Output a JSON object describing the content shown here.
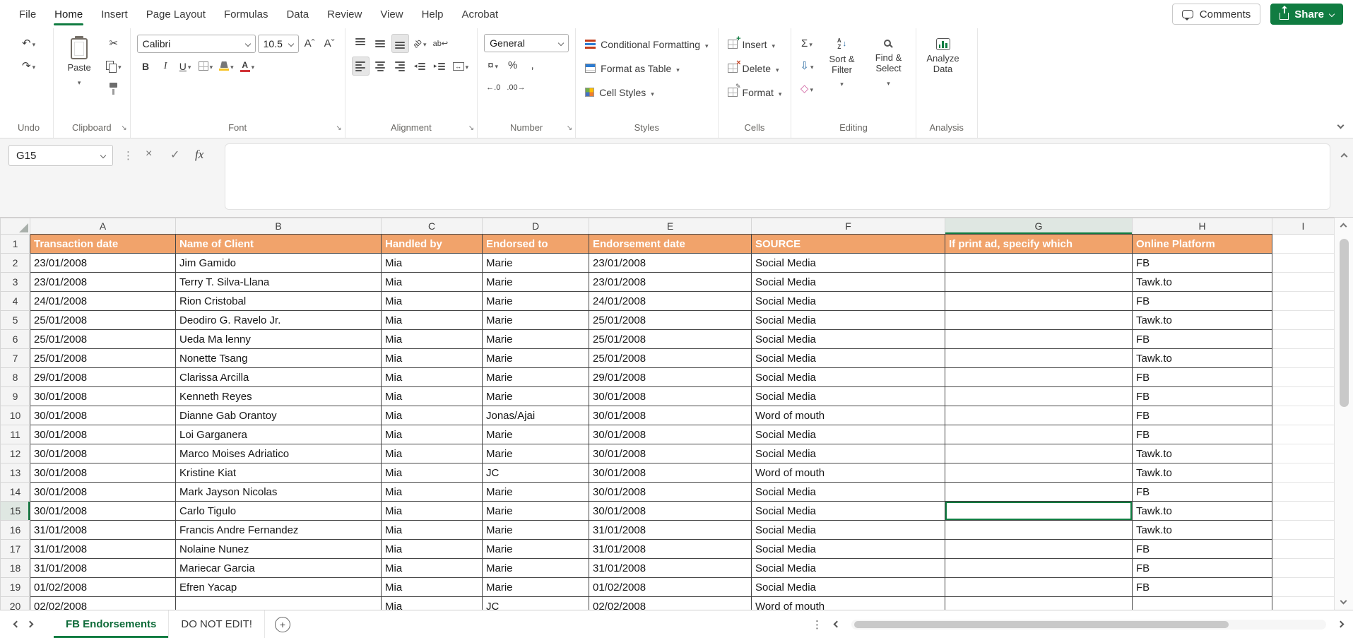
{
  "colors": {
    "accent_green": "#107C41",
    "header_fill": "#F1A36B",
    "header_text": "#FFFFFF",
    "grid_border": "#454545"
  },
  "menu": {
    "items": [
      "File",
      "Home",
      "Insert",
      "Page Layout",
      "Formulas",
      "Data",
      "Review",
      "View",
      "Help",
      "Acrobat"
    ],
    "active_item": "Home",
    "comments_label": "Comments",
    "share_label": "Share"
  },
  "ribbon": {
    "undo": {
      "label": "Undo"
    },
    "clipboard": {
      "label": "Clipboard",
      "paste_label": "Paste"
    },
    "font": {
      "label": "Font",
      "font_name": "Calibri",
      "font_size": "10.5"
    },
    "alignment": {
      "label": "Alignment"
    },
    "number": {
      "label": "Number",
      "format": "General"
    },
    "styles": {
      "label": "Styles",
      "conditional_formatting": "Conditional Formatting",
      "format_as_table": "Format as Table",
      "cell_styles": "Cell Styles"
    },
    "cells": {
      "label": "Cells",
      "insert": "Insert",
      "delete": "Delete",
      "format": "Format"
    },
    "editing": {
      "label": "Editing",
      "sort_filter": "Sort & Filter",
      "find_select": "Find & Select"
    },
    "analysis": {
      "label": "Analysis",
      "analyze_data": "Analyze Data"
    }
  },
  "icons": {
    "undo": "↶",
    "redo": "↷",
    "scissors": "✂",
    "bold": "B",
    "italic": "I",
    "underline": "U",
    "grow_font": "Aˆ",
    "shrink_font": "Aˇ",
    "orientation_ab": "ab",
    "wrap_ab": "ab",
    "wrap_arrow": "↩",
    "merge_arrows": "↔",
    "accounting": "¤",
    "percent": "%",
    "comma": ",",
    "increase_decimal": "←.0",
    "decrease_decimal": ".00→",
    "autosum": "Σ",
    "fill_down": "⇩",
    "clear_diamond": "◇",
    "sort_a": "A",
    "sort_z": "Z",
    "sort_arrow": "↓",
    "indent_left_arrow": "◂",
    "indent_right_arrow": "▸",
    "ellipsis_v": "⋮",
    "plus": "+",
    "cancel": "×",
    "check": "✓",
    "launcher": "↘"
  },
  "formula_bar": {
    "name_box": "G15",
    "fx_label": "fx",
    "formula_value": ""
  },
  "sheet": {
    "column_letters": [
      "A",
      "B",
      "C",
      "D",
      "E",
      "F",
      "G",
      "H",
      "I"
    ],
    "header_row": [
      "Transaction date",
      "Name of Client",
      "Handled by",
      "Endorsed to",
      "Endorsement date",
      "SOURCE",
      "If print ad, specify which",
      "Online Platform"
    ],
    "rows": [
      {
        "n": 2,
        "cells": [
          "23/01/2008",
          "Jim Gamido",
          "Mia",
          "Marie",
          "23/01/2008",
          "Social Media",
          "",
          "FB"
        ]
      },
      {
        "n": 3,
        "cells": [
          "23/01/2008",
          "Terry T. Silva-Llana",
          "Mia",
          "Marie",
          "23/01/2008",
          "Social Media",
          "",
          "Tawk.to"
        ]
      },
      {
        "n": 4,
        "cells": [
          "24/01/2008",
          "Rion Cristobal",
          "Mia",
          "Marie",
          "24/01/2008",
          "Social Media",
          "",
          "FB"
        ]
      },
      {
        "n": 5,
        "cells": [
          "25/01/2008",
          "Deodiro G. Ravelo Jr.",
          "Mia",
          "Marie",
          "25/01/2008",
          "Social Media",
          "",
          "Tawk.to"
        ]
      },
      {
        "n": 6,
        "cells": [
          "25/01/2008",
          "Ueda Ma lenny",
          "Mia",
          "Marie",
          "25/01/2008",
          "Social Media",
          "",
          "FB"
        ]
      },
      {
        "n": 7,
        "cells": [
          "25/01/2008",
          "Nonette Tsang",
          "Mia",
          "Marie",
          "25/01/2008",
          "Social Media",
          "",
          "Tawk.to"
        ]
      },
      {
        "n": 8,
        "cells": [
          "29/01/2008",
          "Clarissa Arcilla",
          "Mia",
          "Marie",
          "29/01/2008",
          "Social Media",
          "",
          "FB"
        ]
      },
      {
        "n": 9,
        "cells": [
          "30/01/2008",
          "Kenneth Reyes",
          "Mia",
          "Marie",
          "30/01/2008",
          "Social Media",
          "",
          "FB"
        ]
      },
      {
        "n": 10,
        "cells": [
          "30/01/2008",
          "Dianne Gab Orantoy",
          "Mia",
          "Jonas/Ajai",
          "30/01/2008",
          "Word of mouth",
          "",
          "FB"
        ]
      },
      {
        "n": 11,
        "cells": [
          "30/01/2008",
          "Loi Garganera",
          "Mia",
          "Marie",
          "30/01/2008",
          "Social Media",
          "",
          "FB"
        ]
      },
      {
        "n": 12,
        "cells": [
          "30/01/2008",
          "Marco Moises Adriatico",
          "Mia",
          "Marie",
          "30/01/2008",
          "Social Media",
          "",
          "Tawk.to"
        ]
      },
      {
        "n": 13,
        "cells": [
          "30/01/2008",
          "Kristine Kiat",
          "Mia",
          "JC",
          "30/01/2008",
          "Word of mouth",
          "",
          "Tawk.to"
        ]
      },
      {
        "n": 14,
        "cells": [
          "30/01/2008",
          "Mark Jayson Nicolas",
          "Mia",
          "Marie",
          "30/01/2008",
          "Social Media",
          "",
          "FB"
        ]
      },
      {
        "n": 15,
        "cells": [
          "30/01/2008",
          "Carlo Tigulo",
          "Mia",
          "Marie",
          "30/01/2008",
          "Social Media",
          "",
          "Tawk.to"
        ]
      },
      {
        "n": 16,
        "cells": [
          "31/01/2008",
          "Francis Andre Fernandez",
          "Mia",
          "Marie",
          "31/01/2008",
          "Social Media",
          "",
          "Tawk.to"
        ]
      },
      {
        "n": 17,
        "cells": [
          "31/01/2008",
          "Nolaine Nunez",
          "Mia",
          "Marie",
          "31/01/2008",
          "Social Media",
          "",
          "FB"
        ]
      },
      {
        "n": 18,
        "cells": [
          "31/01/2008",
          "Mariecar Garcia",
          "Mia",
          "Marie",
          "31/01/2008",
          "Social Media",
          "",
          "FB"
        ]
      },
      {
        "n": 19,
        "cells": [
          "01/02/2008",
          "Efren Yacap",
          "Mia",
          "Marie",
          "01/02/2008",
          "Social Media",
          "",
          "FB"
        ]
      },
      {
        "n": 20,
        "cells": [
          "02/02/2008",
          "",
          "Mia",
          "JC",
          "02/02/2008",
          "Word of mouth",
          "",
          ""
        ]
      }
    ],
    "selection": {
      "cell": "G15",
      "column": "G",
      "row": 15
    }
  },
  "tab_bar": {
    "tabs": [
      {
        "label": "FB Endorsements",
        "active": true
      },
      {
        "label": "DO NOT EDIT!",
        "active": false
      }
    ]
  }
}
